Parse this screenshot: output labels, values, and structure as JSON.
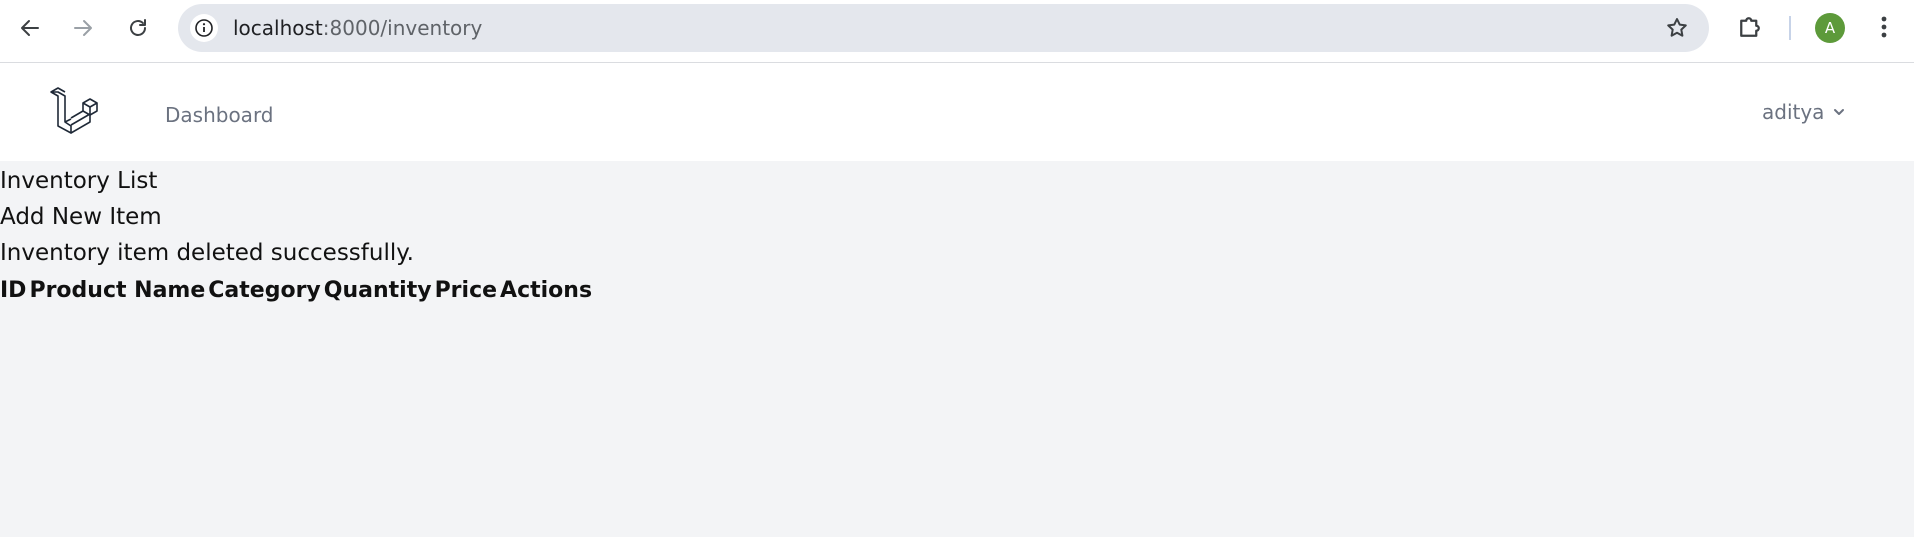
{
  "browser": {
    "url_host": "localhost",
    "url_path": ":8000/inventory",
    "profile_initial": "A",
    "icons": [
      "back-arrow-icon",
      "forward-arrow-icon",
      "reload-icon",
      "site-info-icon",
      "bookmark-star-icon",
      "extensions-puzzle-icon",
      "kebab-menu-icon"
    ],
    "colors": {
      "profile_avatar": "#5d9a3a",
      "omnibox": "#e4e7ed"
    }
  },
  "app_nav": {
    "logo_icon": "laravel-logo-icon",
    "dashboard_label": "Dashboard",
    "user_name": "aditya",
    "user_menu_icon": "chevron-down-icon"
  },
  "main": {
    "page_heading": "Inventory List",
    "add_item_label": "Add New Item",
    "flash_message": "Inventory item deleted successfully.",
    "table": {
      "columns": [
        "ID",
        "Product Name",
        "Category",
        "Quantity",
        "Price",
        "Actions"
      ],
      "rows": []
    }
  }
}
